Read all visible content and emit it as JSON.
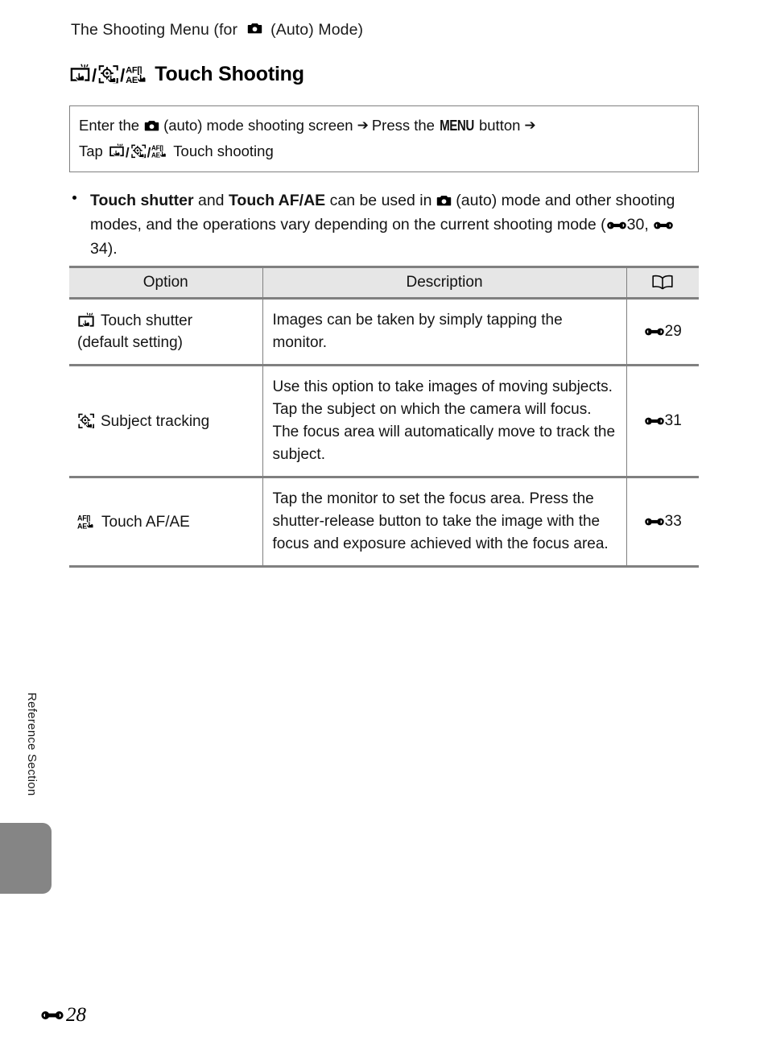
{
  "page": {
    "running_head": "The Shooting Menu (for  (Auto) Mode)",
    "running_head_pre": "The Shooting Menu (for",
    "running_head_post": "(Auto) Mode)",
    "footer_page": "28",
    "side_tab_label": "Reference Section"
  },
  "section": {
    "title": "Touch Shooting",
    "icons": [
      "touch-shutter-icon",
      "subject-tracking-icon",
      "touch-af-ae-icon"
    ],
    "separator": "/"
  },
  "procedure": {
    "line1_part1": "Enter the",
    "line1_part2": "(auto) mode shooting screen",
    "line1_part3": "Press the",
    "line1_menu": "MENU",
    "line1_part4": "button",
    "arrow": "➔",
    "line2_part1": "Tap",
    "line2_part2": "Touch shooting"
  },
  "bullet": {
    "bold1": "Touch shutter",
    "mid1": " and ",
    "bold2": "Touch AF/AE",
    "mid2": " can be used in ",
    "mid3": " (auto) mode and other shooting modes, and the operations vary depending on the current shooting mode (",
    "ref1": "30",
    "comma": ", ",
    "ref2": "34",
    "end": ")."
  },
  "table": {
    "headers": {
      "option": "Option",
      "description": "Description",
      "reference": "book-icon"
    },
    "rows": [
      {
        "icon": "touch-shutter-icon",
        "option_line1": "Touch shutter",
        "option_line2": "(default setting)",
        "description": "Images can be taken by simply tapping the monitor.",
        "ref": "29"
      },
      {
        "icon": "subject-tracking-icon",
        "option_line1": "Subject tracking",
        "option_line2": "",
        "description": "Use this option to take images of moving subjects. Tap the subject on which the camera will focus. The focus area will automatically move to track the subject.",
        "ref": "31"
      },
      {
        "icon": "touch-af-ae-icon",
        "option_line1": "Touch AF/AE",
        "option_line2": "",
        "description": "Tap the monitor to set the focus area. Press the shutter-release button to take the image with the focus and exposure achieved with the focus area.",
        "ref": "33"
      }
    ]
  },
  "colors": {
    "rule": "#808080",
    "header_bg": "#e6e6e6",
    "tab_gray": "#858585",
    "text": "#141414"
  }
}
